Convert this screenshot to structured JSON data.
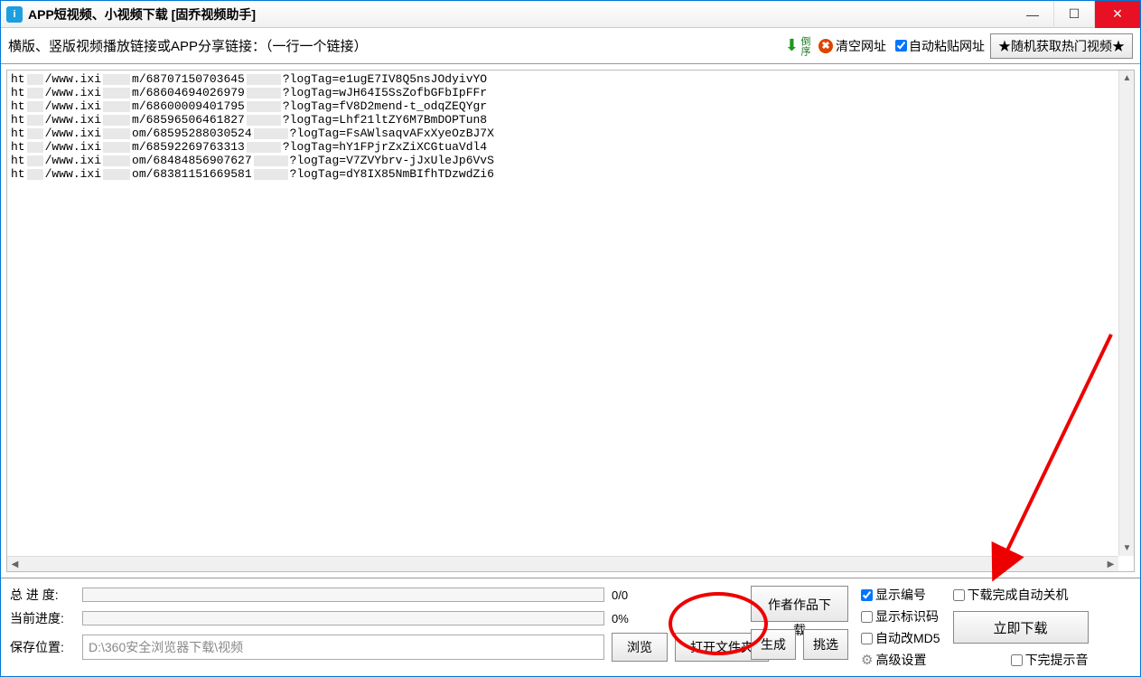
{
  "titlebar": {
    "title": "APP短视频、小视频下载 [固乔视频助手]"
  },
  "toolbar": {
    "hint": "横版、竖版视频播放链接或APP分享链接：（一行一个链接）",
    "sort_label": "倒序",
    "clear_label": "清空网址",
    "autopaste_label": "自动粘贴网址",
    "random_label": "★随机获取热门视频★"
  },
  "urls": [
    {
      "p1": "ht",
      "p2": "/www.ixi",
      "p3": "m/68707150703645",
      "p4": "?logTag=e1ugE7IV8Q5nsJOdyivYO"
    },
    {
      "p1": "ht",
      "p2": "/www.ixi",
      "p3": "m/68604694026979",
      "p4": "?logTag=wJH64I5SsZofbGFbIpFFr"
    },
    {
      "p1": "ht",
      "p2": "/www.ixi",
      "p3": "m/68600009401795",
      "p4": "?logTag=fV8D2mend-t_odqZEQYgr"
    },
    {
      "p1": "ht",
      "p2": "/www.ixi",
      "p3": "m/68596506461827",
      "p4": "?logTag=Lhf21ltZY6M7BmDOPTun8"
    },
    {
      "p1": "ht",
      "p2": "/www.ixi",
      "p3": "om/68595288030524",
      "p4": "?logTag=FsAWlsaqvAFxXyeOzBJ7X"
    },
    {
      "p1": "ht",
      "p2": "/www.ixi",
      "p3": "m/68592269763313",
      "p4": "?logTag=hY1FPjrZxZiXCGtuaVdl4"
    },
    {
      "p1": "ht",
      "p2": "/www.ixi",
      "p3": "om/68484856907627",
      "p4": "?logTag=V7ZVYbrv-jJxUleJp6VvS"
    },
    {
      "p1": "ht",
      "p2": "/www.ixi",
      "p3": "om/68381151669581",
      "p4": "?logTag=dY8IX85NmBIfhTDzwdZi6"
    }
  ],
  "bottom": {
    "total_label": "总 进 度:",
    "total_text": "0/0",
    "current_label": "当前进度:",
    "current_text": "0%",
    "path_label": "保存位置:",
    "path_value": "D:\\360安全浏览器下载\\视频",
    "browse": "浏览",
    "open_folder": "打开文件夹",
    "author_works": "作者作品下载",
    "gen": "生成",
    "pick": "挑选",
    "chk_number": "显示编号",
    "chk_idcode": "显示标识码",
    "chk_md5": "自动改MD5",
    "adv": "高级设置",
    "chk_shutdown": "下载完成自动关机",
    "download_now": "立即下载",
    "chk_sound": "下完提示音"
  }
}
